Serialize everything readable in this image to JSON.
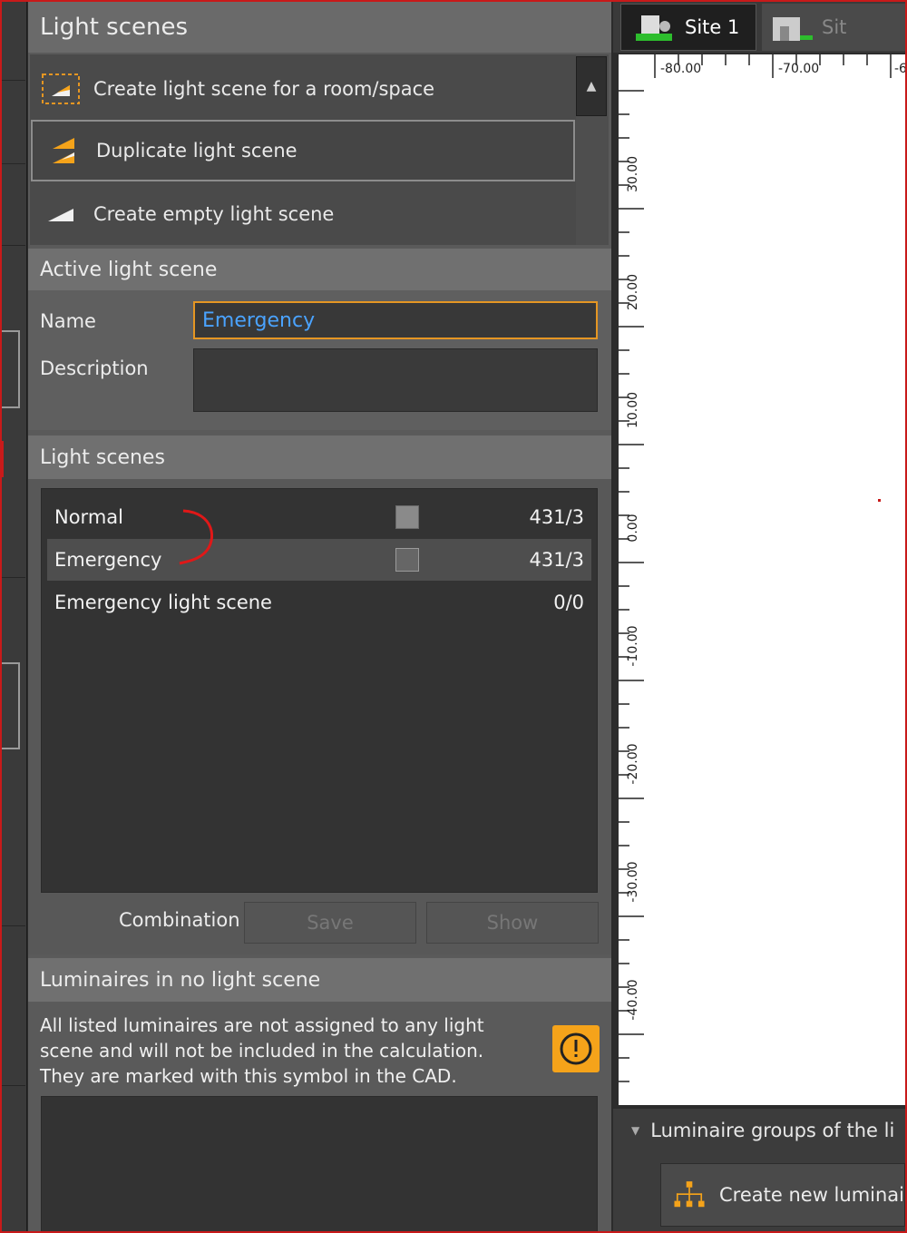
{
  "top_panel": {
    "title": "Light scenes",
    "actions": [
      {
        "label": "Create light scene for a room/space"
      },
      {
        "label": "Duplicate light scene"
      },
      {
        "label": "Create empty light scene"
      }
    ]
  },
  "active_scene": {
    "title": "Active light scene",
    "name_label": "Name",
    "name_value": "Emergency",
    "description_label": "Description",
    "description_value": ""
  },
  "scenes": {
    "title": "Light scenes",
    "rows": [
      {
        "name": "Normal",
        "count": "431/3",
        "has_checkbox": true,
        "active": false
      },
      {
        "name": "Emergency",
        "count": "431/3",
        "has_checkbox": true,
        "active": true
      },
      {
        "name": "Emergency light scene",
        "count": "0/0",
        "has_checkbox": false,
        "active": false
      }
    ],
    "combination_label": "Combination",
    "save_label": "Save",
    "show_label": "Show"
  },
  "luminaires": {
    "title": "Luminaires in no light scene",
    "info_line1": "All listed luminaires are not assigned to any light",
    "info_line2": "scene and will not be included in the calculation.",
    "info_line3": "They are marked with this symbol in the CAD."
  },
  "cad": {
    "tabs": [
      {
        "label": "Site 1",
        "active": true
      },
      {
        "label": "Sit",
        "active": false
      }
    ],
    "ruler_x_labels": [
      "-80.00",
      "-70.00",
      "-6"
    ],
    "ruler_y_labels": [
      "30.00",
      "20.00",
      "10.00",
      "0.00",
      "-10.00",
      "-20.00",
      "-30.00",
      "-40.00"
    ]
  },
  "groups": {
    "title": "Luminaire groups of the li",
    "create_label": "Create new luminai"
  },
  "colors": {
    "accent_orange": "#e59623",
    "warning_yellow": "#f5a31a",
    "frame_red": "#c81a1a",
    "input_text_blue": "#4aa3ff"
  }
}
